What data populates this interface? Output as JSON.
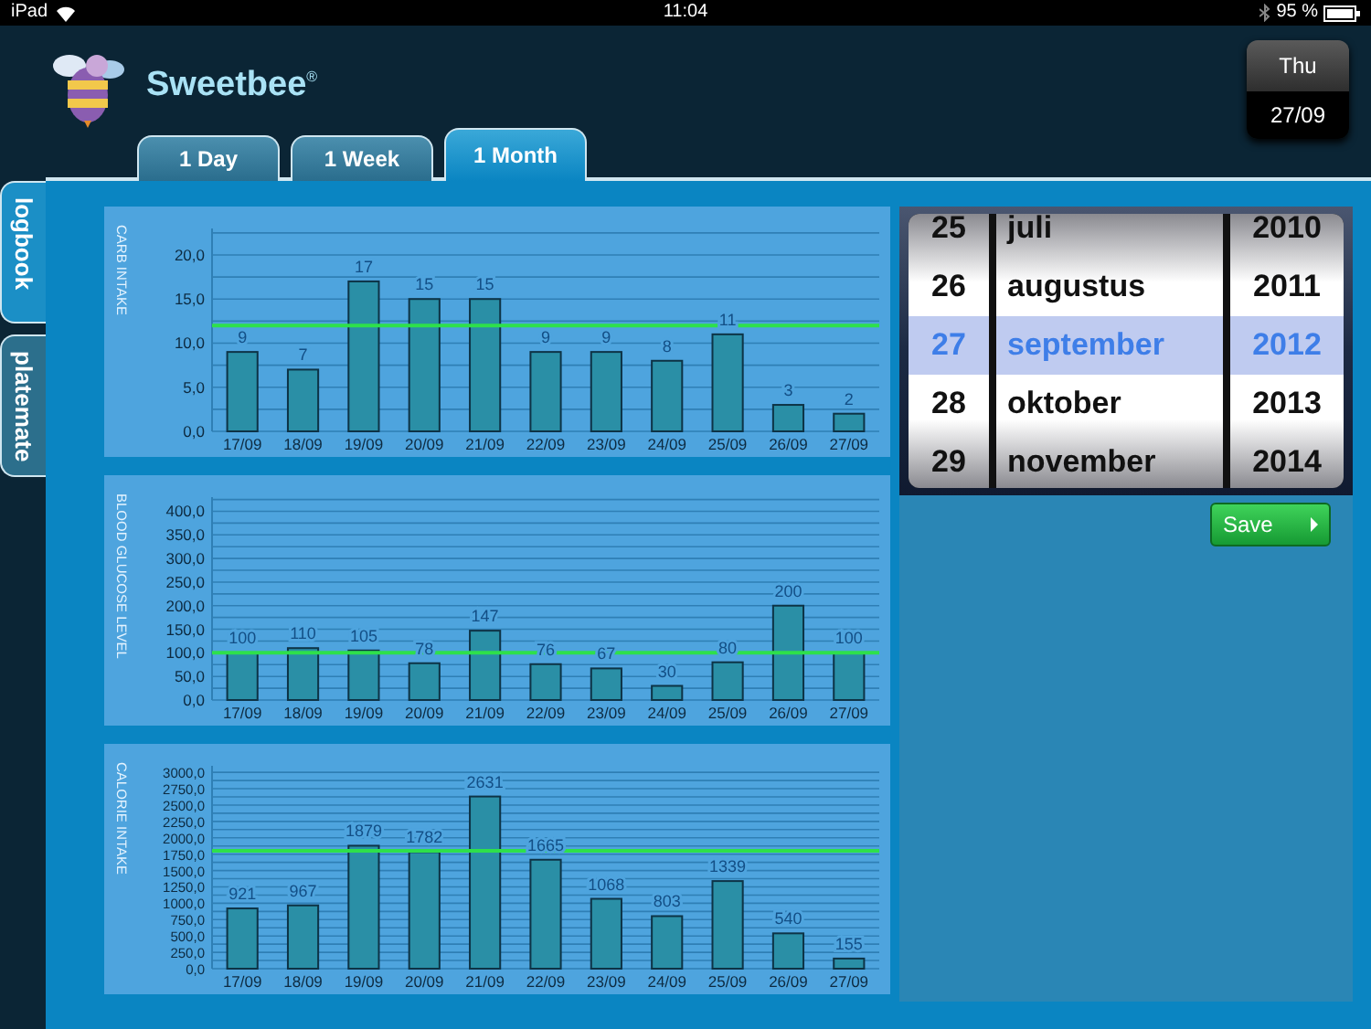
{
  "status_bar": {
    "device": "iPad",
    "time": "11:04",
    "battery": "95 %"
  },
  "header": {
    "app_name": "Sweetbee$^{®}$",
    "date": {
      "weekday": "Thu",
      "day": "27/09"
    }
  },
  "tabs": [
    {
      "label": "1 Day",
      "selected": false
    },
    {
      "label": "1 Week",
      "selected": false
    },
    {
      "label": "1 Month",
      "selected": true
    }
  ],
  "side_tabs": [
    {
      "label": "logbook",
      "selected": true
    },
    {
      "label": "platemate",
      "selected": false
    }
  ],
  "charts": [
    {
      "chart_data": {
        "type": "bar",
        "ylabel": "CARB INTAKE",
        "categories": [
          "17/09",
          "18/09",
          "19/09",
          "20/09",
          "21/09",
          "22/09",
          "23/09",
          "24/09",
          "25/09",
          "26/09",
          "27/09"
        ],
        "values": [
          9,
          7,
          17,
          15,
          15,
          9,
          9,
          8,
          11,
          3,
          2
        ],
        "ylim": [
          0,
          23
        ],
        "yticks": [
          {
            "value": 0,
            "label": "0,0"
          },
          {
            "value": 5,
            "label": "5,0"
          },
          {
            "value": 10,
            "label": "10,0"
          },
          {
            "value": 15,
            "label": "15,0"
          },
          {
            "value": 20,
            "label": "20,0"
          }
        ],
        "data_labels": true,
        "grid": true,
        "ref_lines": [
          {
            "axis": "y",
            "value": 12,
            "color": "#2ee04a"
          }
        ]
      }
    },
    {
      "chart_data": {
        "type": "bar",
        "ylabel": "BLOOD GLUCOSE LEVEL",
        "categories": [
          "17/09",
          "18/09",
          "19/09",
          "20/09",
          "21/09",
          "22/09",
          "23/09",
          "24/09",
          "25/09",
          "26/09",
          "27/09"
        ],
        "values": [
          100,
          110,
          105,
          78,
          147,
          76,
          67,
          30,
          80,
          200,
          100
        ],
        "ylim": [
          0,
          430
        ],
        "yticks": [
          {
            "value": 0,
            "label": "0,0"
          },
          {
            "value": 50,
            "label": "50,0"
          },
          {
            "value": 100,
            "label": "100,0"
          },
          {
            "value": 150,
            "label": "150,0"
          },
          {
            "value": 200,
            "label": "200,0"
          },
          {
            "value": 250,
            "label": "250,0"
          },
          {
            "value": 300,
            "label": "300,0"
          },
          {
            "value": 350,
            "label": "350,0"
          },
          {
            "value": 400,
            "label": "400,0"
          }
        ],
        "data_labels": true,
        "grid": true,
        "ref_lines": [
          {
            "axis": "y",
            "value": 100,
            "color": "#2ee04a"
          }
        ]
      }
    },
    {
      "chart_data": {
        "type": "bar",
        "ylabel": "CALORIE INTAKE",
        "categories": [
          "17/09",
          "18/09",
          "19/09",
          "20/09",
          "21/09",
          "22/09",
          "23/09",
          "24/09",
          "25/09",
          "26/09",
          "27/09"
        ],
        "values": [
          921,
          967,
          1879,
          1782,
          2631,
          1665,
          1068,
          803,
          1339,
          540,
          155
        ],
        "ylim": [
          0,
          3100
        ],
        "yticks": [
          {
            "value": 0,
            "label": "0,0"
          },
          {
            "value": 250,
            "label": "250,0"
          },
          {
            "value": 500,
            "label": "500,0"
          },
          {
            "value": 750,
            "label": "750,0"
          },
          {
            "value": 1000,
            "label": "1000,0"
          },
          {
            "value": 1250,
            "label": "1250,0"
          },
          {
            "value": 1500,
            "label": "1500,0"
          },
          {
            "value": 1750,
            "label": "1750,0"
          },
          {
            "value": 2000,
            "label": "2000,0"
          },
          {
            "value": 2250,
            "label": "2250,0"
          },
          {
            "value": 2500,
            "label": "2500,0"
          },
          {
            "value": 2750,
            "label": "2750,0"
          },
          {
            "value": 3000,
            "label": "3000,0"
          }
        ],
        "data_labels": true,
        "grid": true,
        "ref_lines": [
          {
            "axis": "y",
            "value": 1800,
            "color": "#2ee04a"
          }
        ]
      }
    }
  ],
  "date_picker": {
    "columns": [
      {
        "kind": "day",
        "items": [
          {
            "label": "25",
            "selected": false
          },
          {
            "label": "26",
            "selected": false
          },
          {
            "label": "27",
            "selected": true
          },
          {
            "label": "28",
            "selected": false
          },
          {
            "label": "29",
            "selected": false
          }
        ]
      },
      {
        "kind": "month",
        "items": [
          {
            "label": "juli",
            "selected": false
          },
          {
            "label": "augustus",
            "selected": false
          },
          {
            "label": "september",
            "selected": true
          },
          {
            "label": "oktober",
            "selected": false
          },
          {
            "label": "november",
            "selected": false
          }
        ]
      },
      {
        "kind": "year",
        "items": [
          {
            "label": "2010",
            "selected": false
          },
          {
            "label": "2011",
            "selected": false
          },
          {
            "label": "2012",
            "selected": true
          },
          {
            "label": "2013",
            "selected": false
          },
          {
            "label": "2014",
            "selected": false
          }
        ]
      }
    ]
  },
  "save_button": "Save"
}
